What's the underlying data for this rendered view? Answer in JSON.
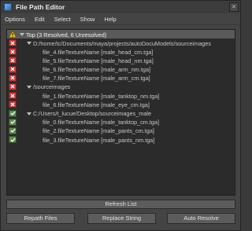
{
  "window": {
    "title": "File Path Editor"
  },
  "menu": [
    "Options",
    "Edit",
    "Select",
    "Show",
    "Help"
  ],
  "tree": {
    "top": {
      "label": "Top (3 Resolved, 6 Unresolved)",
      "status": "warning"
    },
    "groups": [
      {
        "path": "D:/home/tc/Documents/maya/projects/autoDocuModels/sourceimages",
        "status": "error",
        "files": [
          {
            "label": "file_4.fileTextureName [male_head_cm.tga]",
            "status": "error"
          },
          {
            "label": "file_5.fileTextureName [male_head_nm.tga]",
            "status": "error"
          },
          {
            "label": "file_6.fileTextureName [male_arm_nm.tga]",
            "status": "error"
          },
          {
            "label": "file_7.fileTextureName [male_arm_cm.tga]",
            "status": "error"
          }
        ]
      },
      {
        "path": "/sourceimages",
        "status": "error",
        "files": [
          {
            "label": "file_1.fileTextureName [male_tanktop_nm.tga]",
            "status": "error"
          },
          {
            "label": "file_6.fileTextureName [male_eye_cm.tga]",
            "status": "error"
          }
        ]
      },
      {
        "path": "C:/Users/t_lucue/Desktop/sourceimages_male",
        "status": "ok",
        "files": [
          {
            "label": "file_0.fileTextureName [male_tanktop_cm.tga]",
            "status": "ok"
          },
          {
            "label": "file_2.fileTextureName [male_pants_cm.tga]",
            "status": "ok"
          },
          {
            "label": "file_3.fileTextureName [male_pants_nm.tga]",
            "status": "ok"
          }
        ]
      }
    ]
  },
  "buttons": {
    "refresh": "Refresh List",
    "repath": "Repath Files",
    "replace": "Replace String",
    "resolve": "Auto Resolve"
  },
  "colors": {
    "error": "#c93a3a",
    "ok": "#5c8a4c",
    "warning": "#e8c21a"
  }
}
